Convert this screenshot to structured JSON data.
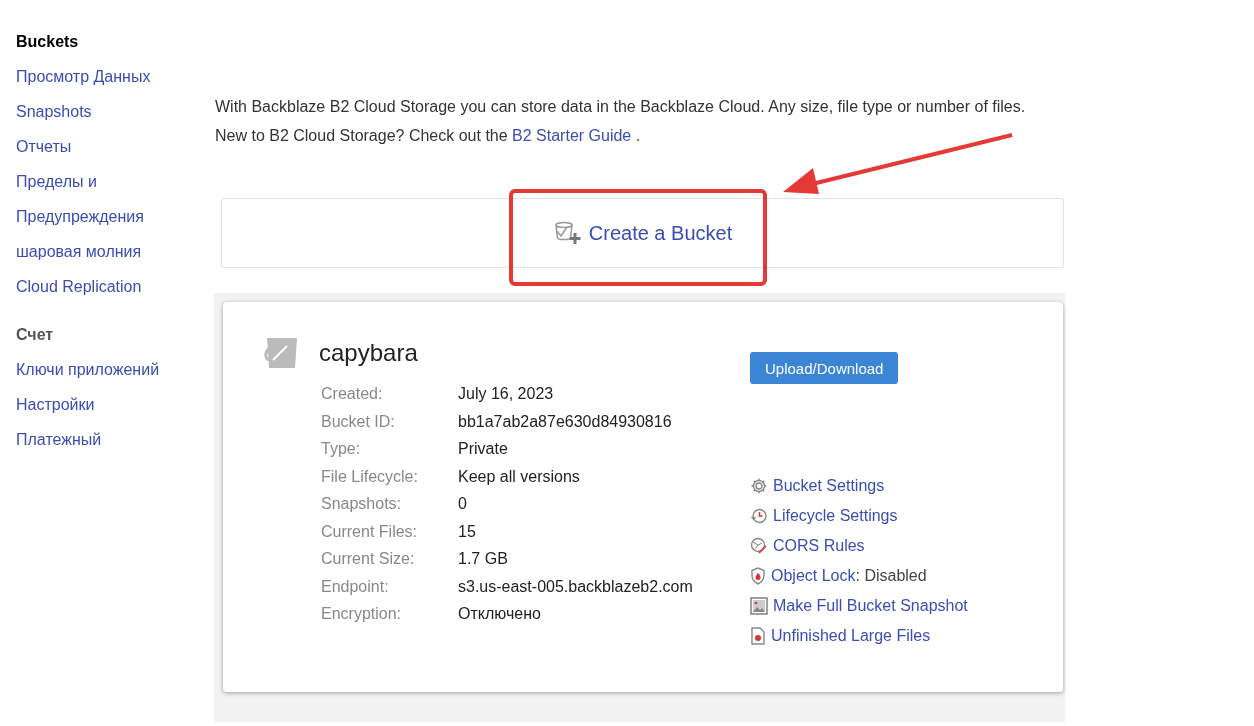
{
  "sidebar": {
    "sections": [
      {
        "title": "Buckets",
        "items": [
          "Просмотр Данных",
          "Snapshots",
          "Отчеты",
          "Пределы и",
          "Предупреждения",
          "шаровая молния",
          "Cloud Replication"
        ]
      },
      {
        "title": "Счет",
        "items": [
          "Ключи приложений",
          "Настройки",
          "Платежный"
        ]
      }
    ]
  },
  "intro": {
    "text": "With Backblaze B2 Cloud Storage you can store data in the Backblaze Cloud. Any size, file type or number of files. New to B2 Cloud Storage? Check out the",
    "link": "B2 Starter Guide",
    "after": " ."
  },
  "create_bucket": {
    "label": "Create a Bucket"
  },
  "bucket": {
    "name": "capybara",
    "upload_button": "Upload/Download",
    "details": [
      {
        "label": "Created:",
        "value": "July 16, 2023"
      },
      {
        "label": "Bucket ID:",
        "value": "bb1a7ab2a87e630d84930816"
      },
      {
        "label": "Type:",
        "value": "Private"
      },
      {
        "label": "File Lifecycle:",
        "value": "Keep all versions"
      },
      {
        "label": "Snapshots:",
        "value": "0"
      },
      {
        "label": "Current Files:",
        "value": "15"
      },
      {
        "label": "Current Size:",
        "value": "1.7 GB"
      },
      {
        "label": "Endpoint:",
        "value": "s3.us-east-005.backblazeb2.com"
      },
      {
        "label": "Encryption:",
        "value": "Отключено"
      }
    ],
    "actions": [
      {
        "kind": "gear",
        "label": "Bucket Settings"
      },
      {
        "kind": "clock",
        "label": "Lifecycle Settings"
      },
      {
        "kind": "globe",
        "label": "CORS Rules"
      },
      {
        "kind": "shield",
        "label": "Object Lock",
        "status": ": Disabled"
      },
      {
        "kind": "image",
        "label": "Make Full Bucket Snapshot"
      },
      {
        "kind": "file",
        "label": "Unfinished Large Files"
      }
    ]
  }
}
